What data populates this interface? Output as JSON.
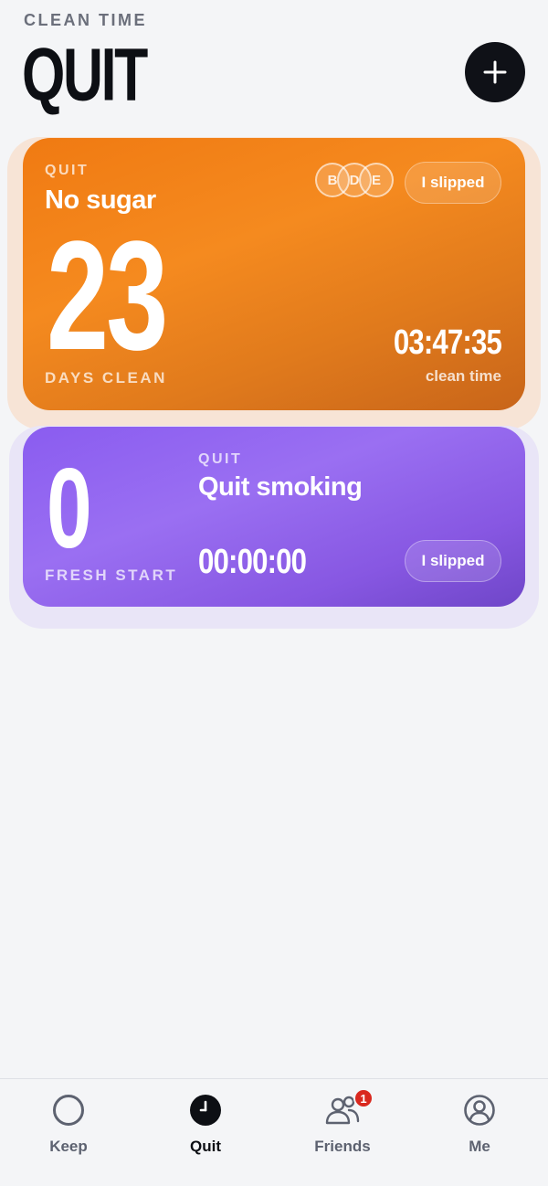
{
  "header": {
    "eyebrow": "CLEAN TIME",
    "title": "QUIT"
  },
  "habits": [
    {
      "category": "QUIT",
      "name": "No sugar",
      "days": "23",
      "days_label": "DAYS CLEAN",
      "timer": "03:47:35",
      "timer_label": "clean time",
      "slip_label": "I slipped",
      "friends": [
        "B",
        "D",
        "E"
      ],
      "color": "#f07a12"
    },
    {
      "category": "QUIT",
      "name": "Quit smoking",
      "days": "0",
      "days_label": "FRESH START",
      "timer": "00:00:00",
      "slip_label": "I slipped",
      "color": "#8a5cf0"
    }
  ],
  "tabs": [
    {
      "label": "Keep",
      "icon": "circle-icon"
    },
    {
      "label": "Quit",
      "icon": "clock-icon",
      "active": true
    },
    {
      "label": "Friends",
      "icon": "friends-icon",
      "badge": "1"
    },
    {
      "label": "Me",
      "icon": "profile-icon"
    }
  ]
}
